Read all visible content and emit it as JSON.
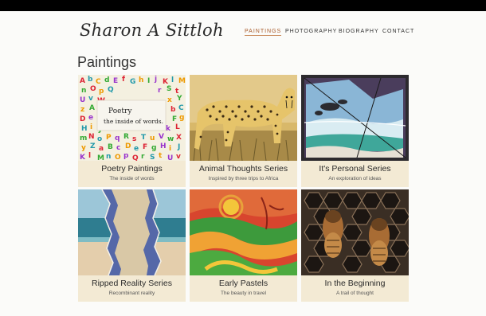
{
  "site": {
    "logo": "Sharon A Sittloh"
  },
  "nav": {
    "items": [
      {
        "label": "PAINTINGS",
        "active": true
      },
      {
        "label": "PHOTOGRAPHY",
        "active": false
      },
      {
        "label": "BIOGRAPHY",
        "active": false
      },
      {
        "label": "CONTACT",
        "active": false
      }
    ]
  },
  "page": {
    "title": "Paintings"
  },
  "gallery": {
    "cards": [
      {
        "title": "Poetry Paintings",
        "subtitle": "The inside of words",
        "image_text": "Poetry\nthe inside of words."
      },
      {
        "title": "Animal Thoughts Series",
        "subtitle": "Inspired by three trips to Africa"
      },
      {
        "title": "It's Personal Series",
        "subtitle": "An exploration of ideas"
      },
      {
        "title": "Ripped Reality Series",
        "subtitle": "Recombinant reality"
      },
      {
        "title": "Early Pastels",
        "subtitle": "The beauty in travel"
      },
      {
        "title": "In the Beginning",
        "subtitle": "A trail of thought"
      }
    ]
  },
  "colors": {
    "accent": "#a85a2a",
    "card_bg": "#f3ead4",
    "page_bg": "#fbfbf9"
  }
}
